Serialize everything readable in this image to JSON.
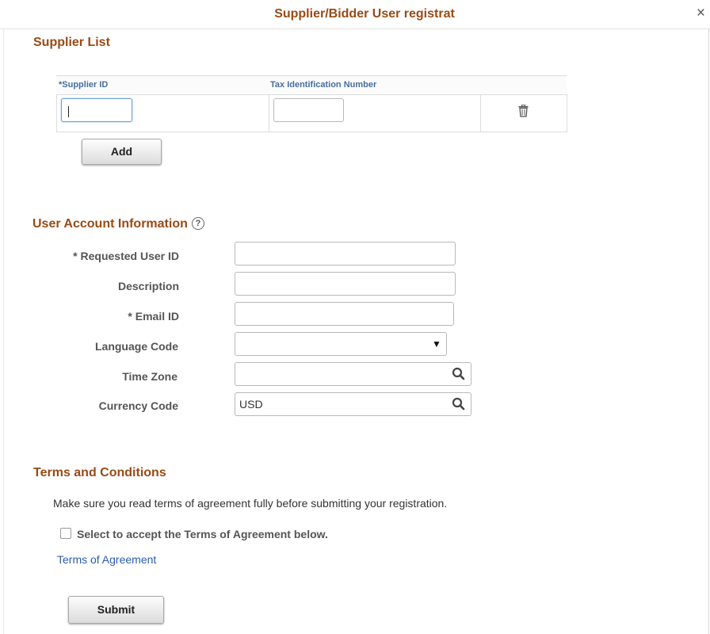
{
  "dialog": {
    "title": "Supplier/Bidder User registrat",
    "close_glyph": "×"
  },
  "supplier_list": {
    "heading": "Supplier List",
    "columns": [
      "*Supplier ID",
      "Tax Identification Number"
    ],
    "rows": [
      {
        "supplier_id": "",
        "tax_id": ""
      }
    ],
    "delete_icon": "trash-icon",
    "add_label": "Add"
  },
  "user_account": {
    "heading": "User Account Information",
    "help_glyph": "?",
    "fields": {
      "requested_user_id": {
        "label": "* Requested User ID",
        "value": ""
      },
      "description": {
        "label": "Description",
        "value": ""
      },
      "email_id": {
        "label": "* Email ID",
        "value": ""
      },
      "language_code": {
        "label": "Language Code",
        "value": ""
      },
      "time_zone": {
        "label": "Time Zone",
        "value": ""
      },
      "currency_code": {
        "label": "Currency Code",
        "value": "USD"
      }
    }
  },
  "terms": {
    "heading": "Terms and Conditions",
    "notice": "Make sure you read terms of agreement fully before submitting your registration.",
    "accept_label": "Select to accept the Terms of Agreement below.",
    "accept_checked": false,
    "link_label": "Terms of Agreement"
  },
  "submit_label": "Submit",
  "colors": {
    "heading": "#9b4a14",
    "grid_header": "#476e9e",
    "link": "#2a5db0"
  }
}
